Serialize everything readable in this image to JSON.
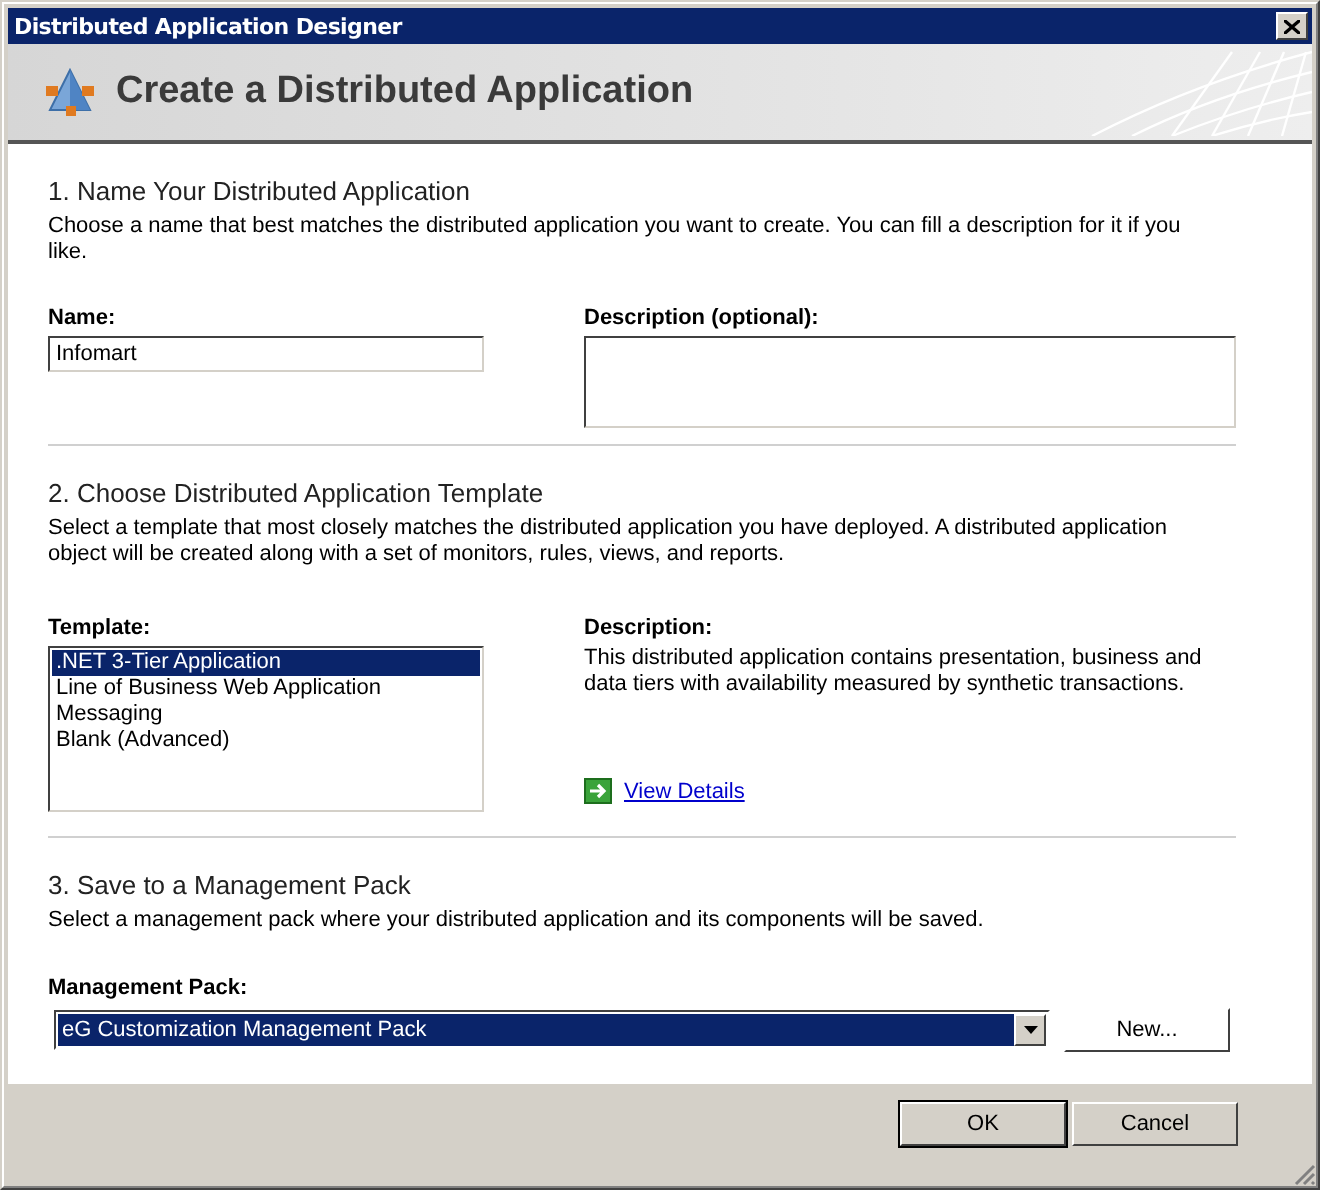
{
  "window": {
    "title": "Distributed Application Designer"
  },
  "header": {
    "title": "Create a Distributed Application"
  },
  "name_section": {
    "heading": "1. Name Your Distributed Application",
    "text": "Choose a name that best matches the distributed application you want to create. You can fill a description for it if you like.",
    "name_label": "Name:",
    "name_value": "Infomart",
    "description_label": "Description (optional):"
  },
  "template_section": {
    "heading": "2. Choose Distributed Application Template",
    "text": "Select a template that most closely matches the distributed application you have deployed. A distributed application object will be created along with a set of monitors, rules, views, and reports.",
    "template_label": "Template:",
    "templates": [
      {
        "label": ".NET 3-Tier Application",
        "selected": true
      },
      {
        "label": "Line of Business Web Application",
        "selected": false
      },
      {
        "label": "Messaging",
        "selected": false
      },
      {
        "label": "Blank (Advanced)",
        "selected": false
      }
    ],
    "description_label": "Description:",
    "description_text": "This distributed application contains presentation, business and data tiers with availability measured by synthetic transactions.",
    "link": "View Details"
  },
  "pack_section": {
    "heading": "3. Save to a Management Pack",
    "text": "Select a management pack where your distributed application and its components will be saved.",
    "label": "Management Pack:",
    "value": "eG Customization Management Pack",
    "new_button": "New..."
  },
  "buttons": [
    {
      "label": "OK",
      "default": true
    },
    {
      "label": "Cancel",
      "default": false
    }
  ]
}
